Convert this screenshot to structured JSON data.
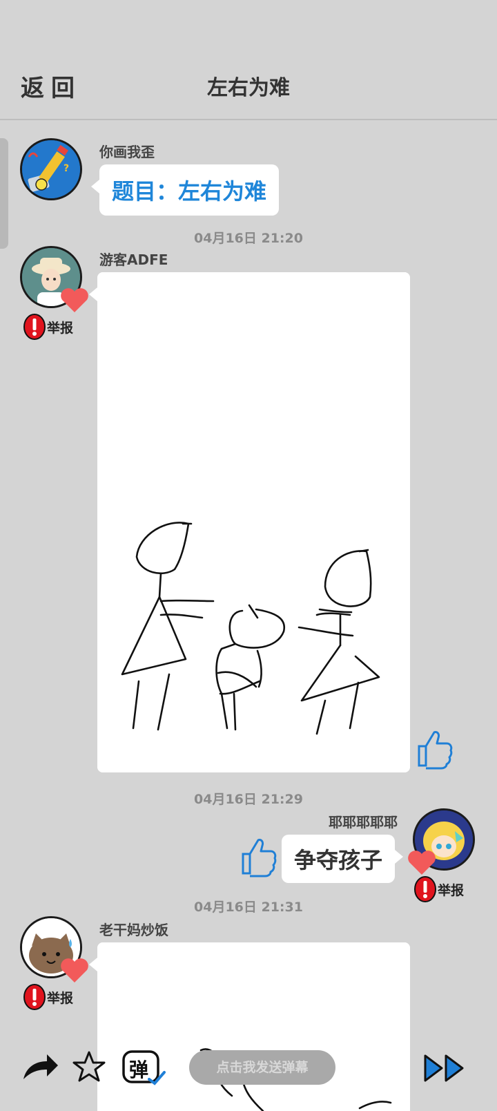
{
  "header": {
    "back_label": "返回",
    "title": "左右为难"
  },
  "topic_message": {
    "username": "你画我歪",
    "text": "题目：左右为难"
  },
  "messages": [
    {
      "timestamp": "04月16日  21:20",
      "username": "游客ADFE",
      "report_label": "举报"
    },
    {
      "timestamp": "04月16日  21:29",
      "username": "耶耶耶耶耶",
      "guess_text": "争夺孩子",
      "report_label": "举报"
    },
    {
      "timestamp": "04月16日  21:31",
      "username": "老干妈炒饭",
      "report_label": "举报"
    }
  ],
  "bottom_bar": {
    "danmu_placeholder": "点击我发送弹幕",
    "danmu_icon_text": "弹",
    "icons": [
      "share-icon",
      "favorite-star-icon",
      "danmu-toggle-icon",
      "fast-forward-icon"
    ]
  },
  "colors": {
    "background": "#d4d4d4",
    "topic_blue": "#1f86d9",
    "heart_red": "#f25a5a",
    "report_red": "#e0141e",
    "like_blue": "#1f7fd6"
  }
}
